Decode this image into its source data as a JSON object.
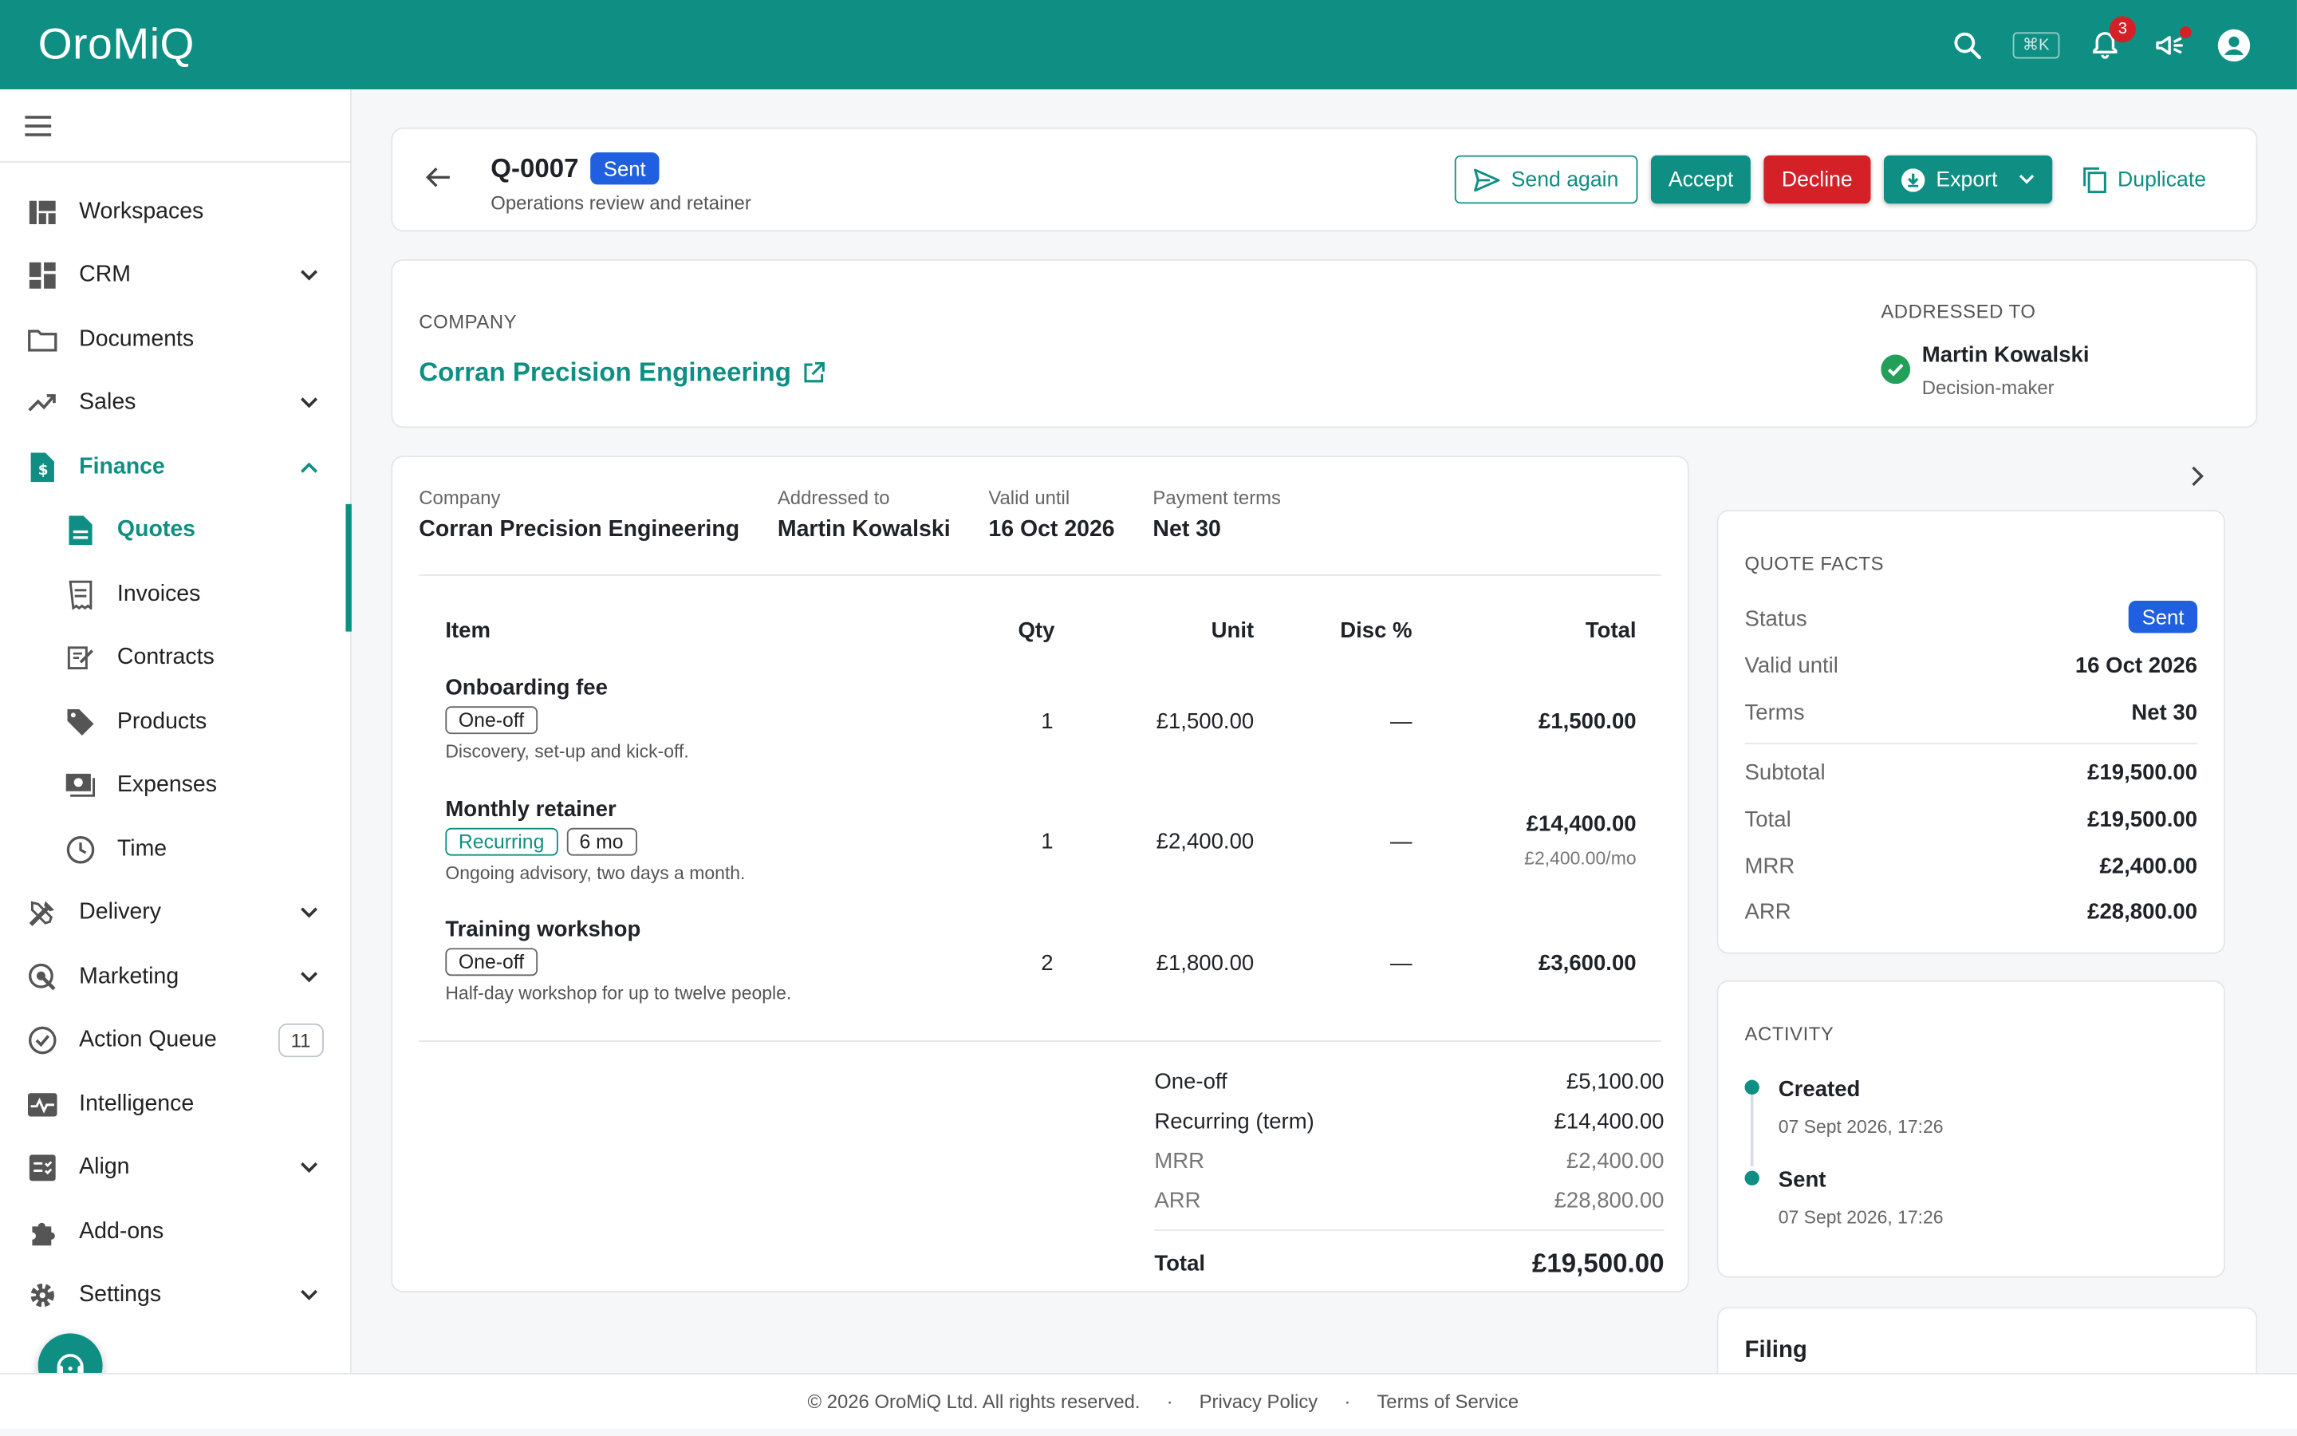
{
  "app": {
    "logo": "OroMiQ",
    "shortcut": "⌘K",
    "notifications_count": "3"
  },
  "colors": {
    "brand": "#0f8f83",
    "status_sent": "#1f5fe0",
    "decline": "#d42027"
  },
  "sidebar": {
    "items": [
      {
        "label": "Workspaces",
        "icon": "workspaces-icon"
      },
      {
        "label": "CRM",
        "icon": "dashboard-icon"
      },
      {
        "label": "Documents",
        "icon": "folder-icon"
      },
      {
        "label": "Sales",
        "icon": "trending-up-icon"
      },
      {
        "label": "Finance",
        "icon": "invoice-dollar-icon"
      },
      {
        "label": "Quotes",
        "icon": "document-icon"
      },
      {
        "label": "Invoices",
        "icon": "receipt-icon"
      },
      {
        "label": "Contracts",
        "icon": "contract-icon"
      },
      {
        "label": "Products",
        "icon": "tag-icon"
      },
      {
        "label": "Expenses",
        "icon": "cash-icon"
      },
      {
        "label": "Time",
        "icon": "clock-icon"
      },
      {
        "label": "Delivery",
        "icon": "tools-icon"
      },
      {
        "label": "Marketing",
        "icon": "campaign-icon"
      },
      {
        "label": "Action Queue",
        "icon": "check-circle-icon",
        "count": "11"
      },
      {
        "label": "Intelligence",
        "icon": "insights-icon"
      },
      {
        "label": "Align",
        "icon": "checklist-icon"
      },
      {
        "label": "Add-ons",
        "icon": "puzzle-icon"
      },
      {
        "label": "Settings",
        "icon": "gear-icon"
      }
    ]
  },
  "header": {
    "number": "Q-0007",
    "status": "Sent",
    "subtitle": "Operations review and retainer",
    "buttons": {
      "send_again": "Send again",
      "accept": "Accept",
      "decline": "Decline",
      "export": "Export",
      "duplicate": "Duplicate"
    }
  },
  "company_card": {
    "company_label": "COMPANY",
    "company": "Corran Precision Engineering",
    "addressed_label": "ADDRESSED TO",
    "contact": "Martin Kowalski",
    "role": "Decision-maker"
  },
  "quote": {
    "meta": [
      {
        "label": "Company",
        "value": "Corran Precision Engineering"
      },
      {
        "label": "Addressed to",
        "value": "Martin Kowalski"
      },
      {
        "label": "Valid until",
        "value": "16 Oct 2026"
      },
      {
        "label": "Payment terms",
        "value": "Net 30"
      }
    ],
    "columns": {
      "item": "Item",
      "qty": "Qty",
      "unit": "Unit",
      "disc": "Disc %",
      "total": "Total"
    },
    "rows": [
      {
        "name": "Onboarding fee",
        "tags": [
          "One-off"
        ],
        "desc": "Discovery, set-up and kick-off.",
        "qty": "1",
        "unit": "£1,500.00",
        "disc": "—",
        "total": "£1,500.00",
        "sub": ""
      },
      {
        "name": "Monthly retainer",
        "tags": [
          "Recurring",
          "6 mo"
        ],
        "desc": "Ongoing advisory, two days a month.",
        "qty": "1",
        "unit": "£2,400.00",
        "disc": "—",
        "total": "£14,400.00",
        "sub": "£2,400.00/mo"
      },
      {
        "name": "Training workshop",
        "tags": [
          "One-off"
        ],
        "desc": "Half-day workshop for up to twelve people.",
        "qty": "2",
        "unit": "£1,800.00",
        "disc": "—",
        "total": "£3,600.00",
        "sub": ""
      }
    ],
    "totals": [
      {
        "label": "One-off",
        "value": "£5,100.00"
      },
      {
        "label": "Recurring (term)",
        "value": "£14,400.00"
      },
      {
        "label": "MRR",
        "value": "£2,400.00"
      },
      {
        "label": "ARR",
        "value": "£28,800.00"
      }
    ],
    "grand_label": "Total",
    "grand_value": "£19,500.00"
  },
  "facts": {
    "title": "QUOTE FACTS",
    "status_label": "Status",
    "status": "Sent",
    "rows": [
      {
        "label": "Valid until",
        "value": "16 Oct 2026"
      },
      {
        "label": "Terms",
        "value": "Net 30"
      },
      {
        "label": "Subtotal",
        "value": "£19,500.00"
      },
      {
        "label": "Total",
        "value": "£19,500.00"
      },
      {
        "label": "MRR",
        "value": "£2,400.00"
      },
      {
        "label": "ARR",
        "value": "£28,800.00"
      }
    ]
  },
  "activity": {
    "title": "ACTIVITY",
    "events": [
      {
        "title": "Created",
        "date": "07 Sept 2026, 17:26"
      },
      {
        "title": "Sent",
        "date": "07 Sept 2026, 17:26"
      }
    ]
  },
  "filing": {
    "title": "Filing"
  },
  "footer": {
    "copyright": "© 2026 OroMiQ Ltd. All rights reserved.",
    "sep": "·",
    "privacy": "Privacy Policy",
    "terms": "Terms of Service"
  }
}
